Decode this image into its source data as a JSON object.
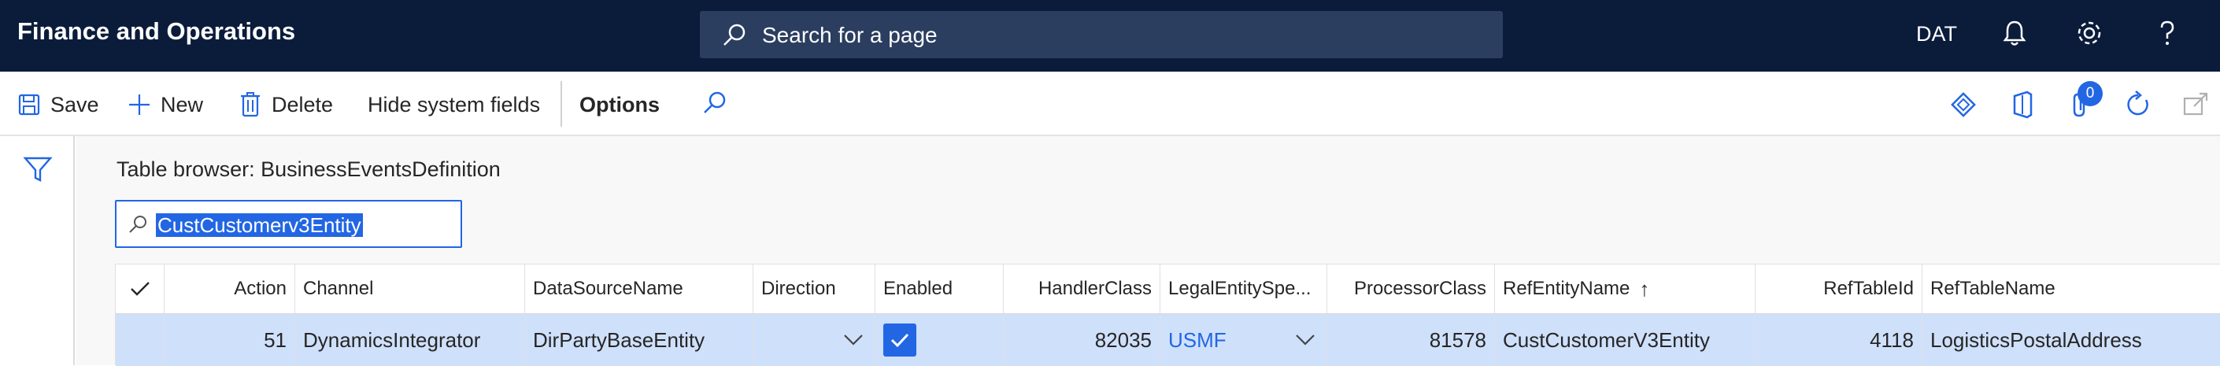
{
  "app": {
    "title": "Finance and Operations",
    "company": "DAT"
  },
  "search": {
    "placeholder": "Search for a page"
  },
  "toolbar": {
    "save_label": "Save",
    "new_label": "New",
    "delete_label": "Delete",
    "hide_label": "Hide system fields",
    "options_label": "Options",
    "attachments_count": "0"
  },
  "page": {
    "title": "Table browser: BusinessEventsDefinition"
  },
  "filter": {
    "value": "CustCustomerv3Entity"
  },
  "grid": {
    "columns": [
      "Action",
      "Channel",
      "DataSourceName",
      "Direction",
      "Enabled",
      "HandlerClass",
      "LegalEntitySpe...",
      "ProcessorClass",
      "RefEntityName",
      "RefTableId",
      "RefTableName"
    ],
    "sort_indicator": "↑",
    "rows": [
      {
        "action": "51",
        "channel": "DynamicsIntegrator",
        "datasource": "DirPartyBaseEntity",
        "direction": "",
        "enabled": true,
        "handler": "82035",
        "legal": "USMF",
        "processor": "81578",
        "refentity": "CustCustomerV3Entity",
        "reftableid": "4118",
        "reftablename": "LogisticsPostalAddress"
      }
    ]
  },
  "colors": {
    "nav": "#0b1c3b",
    "accent": "#2266e3",
    "row_selected": "#cfe0fb"
  }
}
